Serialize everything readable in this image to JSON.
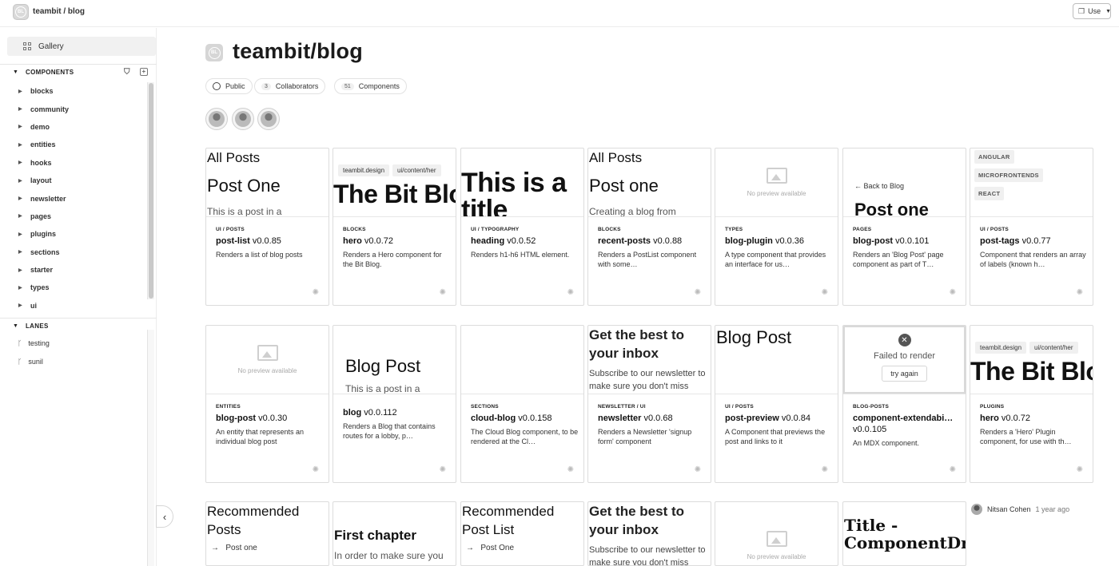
{
  "topbar": {
    "brand": "teambit / blog",
    "use_label": "Use",
    "logo_text": "BL"
  },
  "sidebar": {
    "gallery_label": "Gallery",
    "components_header": "COMPONENTS",
    "items": [
      "blocks",
      "community",
      "demo",
      "entities",
      "hooks",
      "layout",
      "newsletter",
      "pages",
      "plugins",
      "sections",
      "starter",
      "types",
      "ui"
    ],
    "lanes_header": "LANES",
    "lanes": [
      "testing",
      "sunil"
    ]
  },
  "scope": {
    "title": "teambit/blog",
    "icon_text": "BL",
    "visibility": "Public",
    "collaborators_count": "3",
    "collaborators_label": "Collaborators",
    "components_count": "51",
    "components_label": "Components"
  },
  "cards": [
    {
      "ns": "UI / POSTS",
      "name": "post-list",
      "ver": "v0.0.85",
      "desc": "Renders a list of blog posts",
      "p1": "All Posts",
      "p2": "Post One",
      "p3": "This is a post in a"
    },
    {
      "ns": "BLOCKS",
      "name": "hero",
      "ver": "v0.0.72",
      "desc": "Renders a Hero component for the Bit Blog.",
      "tab1": "teambit.design",
      "tab2": "ui/content/her",
      "p1": "The Bit Blo"
    },
    {
      "ns": "UI / TYPOGRAPHY",
      "name": "heading",
      "ver": "v0.0.52",
      "desc": "Renders h1-h6 HTML element.",
      "p1": "This is a",
      "p2": "title"
    },
    {
      "ns": "BLOCKS",
      "name": "recent-posts",
      "ver": "v0.0.88",
      "desc": "Renders a PostList component with some…",
      "p1": "All Posts",
      "p2": "Post one",
      "p3": "Creating a blog from"
    },
    {
      "ns": "TYPES",
      "name": "blog-plugin",
      "ver": "v0.0.36",
      "desc": "A type component that provides an interface for us…",
      "no_preview": "No preview available"
    },
    {
      "ns": "PAGES",
      "name": "blog-post",
      "ver": "v0.0.101",
      "desc": "Renders an 'Blog Post' page component as part of T…",
      "back": "← Back to Blog",
      "p1": "Post one"
    },
    {
      "ns": "UI / POSTS",
      "name": "post-tags",
      "ver": "v0.0.77",
      "desc": "Component that renders an array of labels (known h…",
      "tags": [
        "ANGULAR",
        "MICROFRONTENDS",
        "REACT"
      ]
    },
    {
      "ns": "ENTITIES",
      "name": "blog-post",
      "ver": "v0.0.30",
      "desc": "An entity that represents an individual blog post",
      "no_preview": "No preview available"
    },
    {
      "ns": "",
      "name": "blog",
      "ver": "v0.0.112",
      "desc": "Renders a Blog that contains routes for a lobby, p…",
      "p1": "Blog Post",
      "p2": "This is a post in a"
    },
    {
      "ns": "SECTIONS",
      "name": "cloud-blog",
      "ver": "v0.0.158",
      "desc": "The Cloud Blog component, to be rendered at the Cl…"
    },
    {
      "ns": "NEWSLETTER / UI",
      "name": "newsletter",
      "ver": "v0.0.68",
      "desc": "Renders a Newsletter 'signup form' component",
      "p1": "Get the best to your inbox",
      "p2": "Subscribe to our newsletter to make sure you don't miss"
    },
    {
      "ns": "UI / POSTS",
      "name": "post-preview",
      "ver": "v0.0.84",
      "desc": "A Component that previews the post and links to it",
      "p1": "Blog Post"
    },
    {
      "ns": "BLOG-POSTS",
      "name": "component-extendabi…",
      "ver": "v0.0.105",
      "desc": "An MDX component.",
      "failed": "Failed to render",
      "try": "try again"
    },
    {
      "ns": "PLUGINS",
      "name": "hero",
      "ver": "v0.0.72",
      "desc": "Renders a 'Hero' Plugin component, for use with th…",
      "tab1": "teambit.design",
      "tab2": "ui/content/her",
      "p1": "The Bit Blo"
    }
  ],
  "row3": [
    {
      "p1": "Recommended Posts",
      "p2": "Post one"
    },
    {
      "p1": "First chapter",
      "p2": "In order to make sure you"
    },
    {
      "p1": "Recommended Post List",
      "p2": "Post One"
    },
    {
      "p1": "Get the best to your inbox",
      "p2": "Subscribe to our newsletter to make sure you don't miss"
    },
    {
      "no_preview": "No preview available"
    },
    {
      "p1": "Title - ComponentDriven"
    }
  ],
  "author": {
    "name": "Nitsan Cohen",
    "time": "1 year ago"
  }
}
